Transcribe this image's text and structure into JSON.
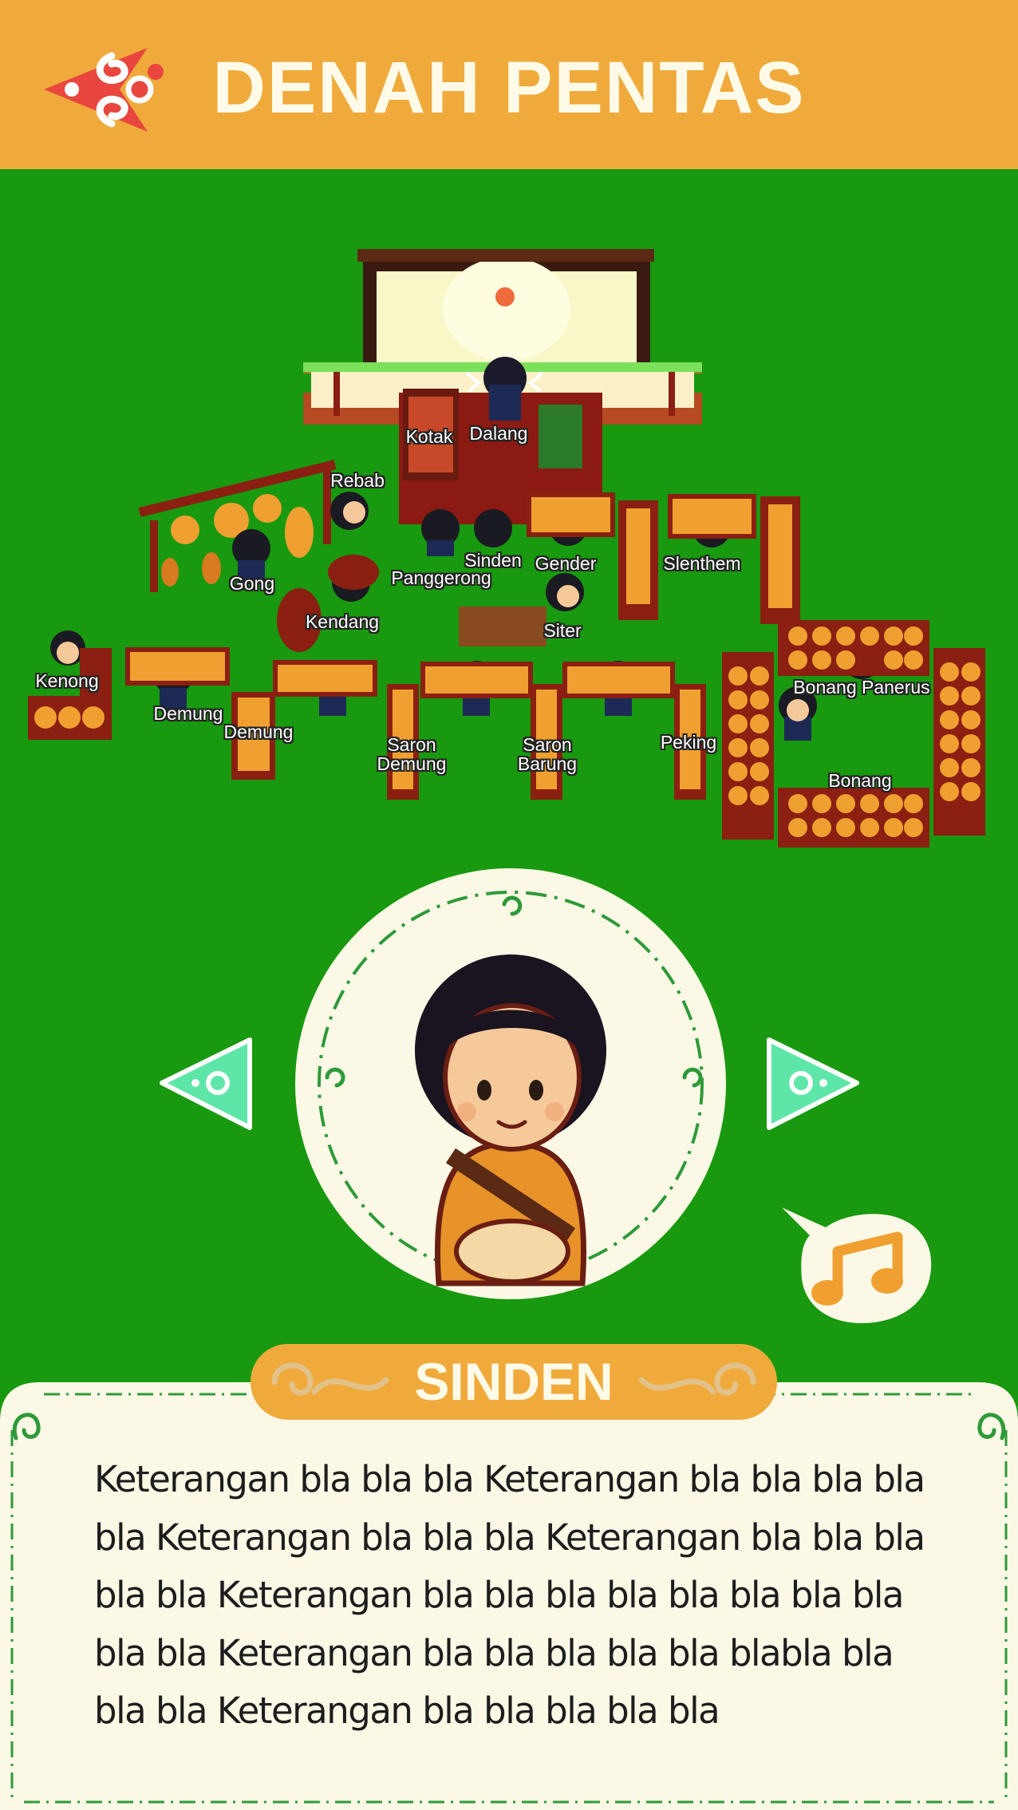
{
  "header": {
    "title": "DENAH PENTAS",
    "back_icon": "ornament-arrow-left-icon"
  },
  "stage_labels": {
    "kotak": "Kotak",
    "dalang": "Dalang",
    "rebab": "Rebab",
    "gong": "Gong",
    "panggerong": "Panggerong",
    "sinden": "Sinden",
    "gender": "Gender",
    "slenthem": "Slenthem",
    "kendang": "Kendang",
    "siter": "Siter",
    "kenong": "Kenong",
    "demung_1": "Demung",
    "demung_2": "Demung",
    "saron_demung": "Saron\nDemung",
    "saron_barung": "Saron\nBarung",
    "peking": "Peking",
    "bonang_panerus": "Bonang Panerus",
    "bonang": "Bonang"
  },
  "navigation": {
    "prev_icon": "triangle-left-icon",
    "next_icon": "triangle-right-icon"
  },
  "music": {
    "icon": "music-note-icon"
  },
  "character": {
    "name": "SINDEN",
    "description": "Keterangan bla bla bla Keterangan bla bla bla bla bla  Keterangan bla bla bla Keterangan bla bla bla bla bla Keterangan bla bla bla bla bla bla bla bla bla bla Keterangan bla bla bla bla bla blabla bla bla bla Keterangan bla bla bla bla bla"
  },
  "colors": {
    "header": "#f0aa3c",
    "background": "#18990f",
    "panel": "#fbf8e6",
    "accent_green": "#5de6a8",
    "brown": "#7a1c10"
  }
}
